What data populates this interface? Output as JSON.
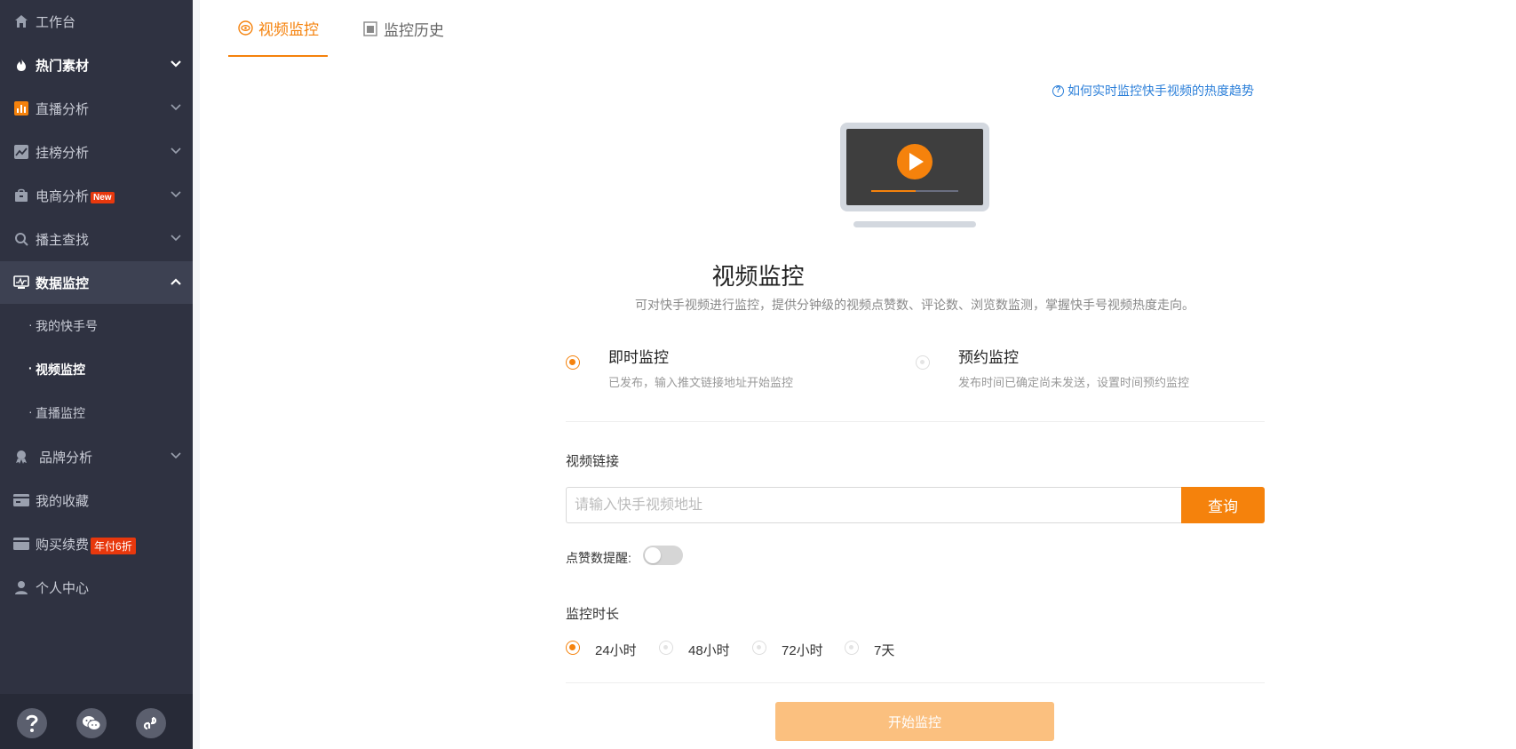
{
  "sidebar": {
    "items": [
      {
        "label": "工作台",
        "icon": "home-icon"
      },
      {
        "label": "热门素材",
        "icon": "fire-icon"
      },
      {
        "label": "直播分析",
        "icon": "bar-chart-icon"
      },
      {
        "label": "挂榜分析",
        "icon": "trend-icon"
      },
      {
        "label": "电商分析",
        "icon": "shopping-bag-icon",
        "badge": "New"
      },
      {
        "label": "播主查找",
        "icon": "search-icon"
      },
      {
        "label": "数据监控",
        "icon": "monitor-icon"
      },
      {
        "label": "品牌分析",
        "icon": "award-icon"
      },
      {
        "label": "我的收藏",
        "icon": "card-icon"
      },
      {
        "label": "购买续费",
        "icon": "wallet-icon",
        "badge": "年付6折"
      },
      {
        "label": "个人中心",
        "icon": "user-icon"
      }
    ],
    "sub_items": [
      {
        "label": "我的快手号"
      },
      {
        "label": "视频监控"
      },
      {
        "label": "直播监控"
      }
    ],
    "sub_dot": "·",
    "footer": [
      "help-icon",
      "wechat-icon",
      "link-icon"
    ],
    "colors": {
      "bg": "#2f3241",
      "accent": "#f5820c",
      "badge": "#e8380d"
    }
  },
  "tabs": [
    {
      "label": "视频监控",
      "active": true
    },
    {
      "label": "监控历史",
      "active": false
    }
  ],
  "main": {
    "help_link": "如何实时监控快手视频的热度趋势",
    "title": "视频监控",
    "description": "可对快手视频进行监控，提供分钟级的视频点赞数、评论数、浏览数监测，掌握快手号视频热度走向。",
    "modes": [
      {
        "title": "即时监控",
        "subtitle": "已发布，输入推文链接地址开始监控",
        "selected": true
      },
      {
        "title": "预约监控",
        "subtitle": "发布时间已确定尚未发送，设置时间预约监控",
        "selected": false
      }
    ],
    "video_link_label": "视频链接",
    "input_placeholder": "请输入快手视频地址",
    "query_button": "查询",
    "like_reminder_label": "点赞数提醒:",
    "like_reminder_on": false,
    "duration_label": "监控时长",
    "durations": [
      {
        "label": "24小时",
        "selected": true
      },
      {
        "label": "48小时",
        "selected": false
      },
      {
        "label": "72小时",
        "selected": false
      },
      {
        "label": "7天",
        "selected": false
      }
    ],
    "start_button": "开始监控"
  }
}
